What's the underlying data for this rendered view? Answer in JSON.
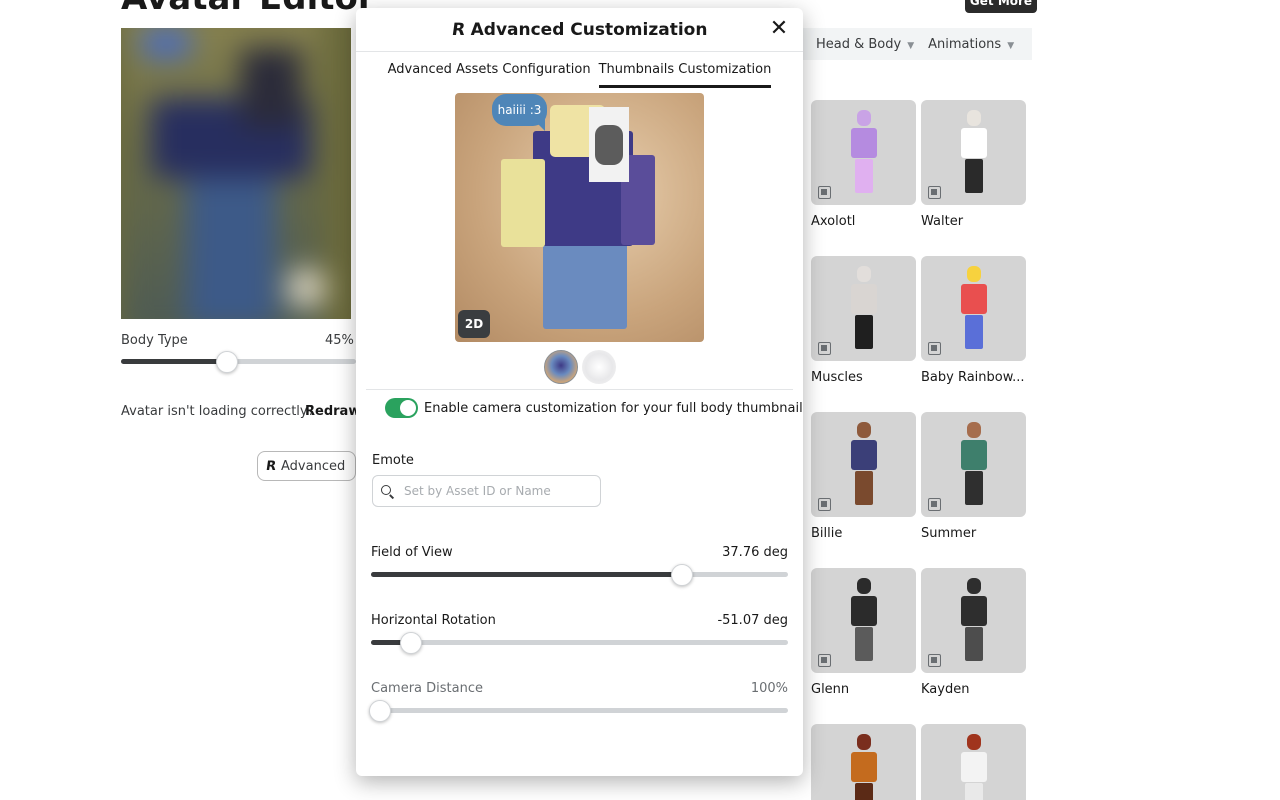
{
  "page": {
    "title": "Avatar Editor",
    "get_more_label": "Get More",
    "body_type": {
      "label": "Body Type",
      "value_text": "45%",
      "value": 0.45
    },
    "loading_text": "Avatar isn't loading correctly?",
    "redraw_label": "Redraw",
    "advanced_label": "Advanced",
    "nav_tabs": [
      {
        "label": "Head & Body"
      },
      {
        "label": "Animations"
      }
    ],
    "items": [
      {
        "name": "Axolotl",
        "colors": [
          "#c9a3e6",
          "#b58be0",
          "#e0b0f0"
        ]
      },
      {
        "name": "Walter",
        "colors": [
          "#e8e4de",
          "#ffffff",
          "#2a2a2a"
        ]
      },
      {
        "name": "Muscles",
        "colors": [
          "#e2dedb",
          "#d9d5d2",
          "#1f1f1f"
        ]
      },
      {
        "name": "Baby Rainbow...",
        "colors": [
          "#f7d23e",
          "#e94f4f",
          "#5a6fd8"
        ]
      },
      {
        "name": "Billie",
        "colors": [
          "#8e5a3c",
          "#3b3f78",
          "#7a4a2e"
        ]
      },
      {
        "name": "Summer",
        "colors": [
          "#a66d4d",
          "#3e7f6c",
          "#2f2f2f"
        ]
      },
      {
        "name": "Glenn",
        "colors": [
          "#2b2b2b",
          "#2b2b2b",
          "#5b5b5b"
        ]
      },
      {
        "name": "Kayden",
        "colors": [
          "#2e2e2e",
          "#2e2e2e",
          "#4d4d4d"
        ]
      },
      {
        "name": "",
        "colors": [
          "#7a2e1e",
          "#c46b1e",
          "#5b2a16"
        ]
      },
      {
        "name": "",
        "colors": [
          "#a0341d",
          "#f3f3f3",
          "#e9e9e9"
        ]
      }
    ]
  },
  "modal": {
    "title": "Advanced Customization",
    "tabs": [
      {
        "label": "Advanced Assets Configuration",
        "active": false
      },
      {
        "label": "Thumbnails Customization",
        "active": true
      }
    ],
    "preview": {
      "bubble_text": "haiiii :3",
      "badge_2d": "2D"
    },
    "toggle": {
      "label": "Enable camera customization for your full body thumbnail",
      "on": true
    },
    "emote": {
      "label": "Emote",
      "placeholder": "Set by Asset ID or Name",
      "value": ""
    },
    "sliders": [
      {
        "label": "Field of View",
        "value_text": "37.76 deg",
        "fraction": 0.745,
        "muted": false
      },
      {
        "label": "Horizontal Rotation",
        "value_text": "-51.07 deg",
        "fraction": 0.095,
        "muted": false
      },
      {
        "label": "Camera Distance",
        "value_text": "100%",
        "fraction": 0.022,
        "muted": true
      }
    ]
  },
  "colors": {
    "toggle_on": "#2aa25e",
    "slider_fill": "#393b3d",
    "track": "#d0d3d6"
  },
  "icons": [
    "roblox-logo-icon",
    "close-icon",
    "search-icon",
    "chevron-down-icon",
    "bundle-icon"
  ]
}
